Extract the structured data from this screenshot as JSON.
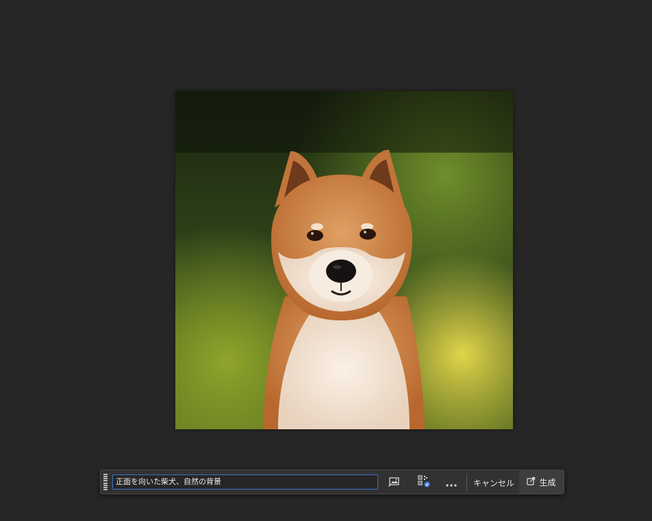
{
  "taskbar": {
    "prompt_value": "正面を向いた柴犬、自然の背景",
    "buttons": {
      "image_reference": "image-reference-icon",
      "content_credentials": "qr-check-icon",
      "more": "more-options-icon",
      "cancel_label": "キャンセル",
      "generate_label": "生成"
    }
  },
  "colors": {
    "workspace_bg": "#262626",
    "bar_bg": "#323232",
    "input_focus_border": "#3b6fcf",
    "badge_blue": "#3d7eea"
  }
}
